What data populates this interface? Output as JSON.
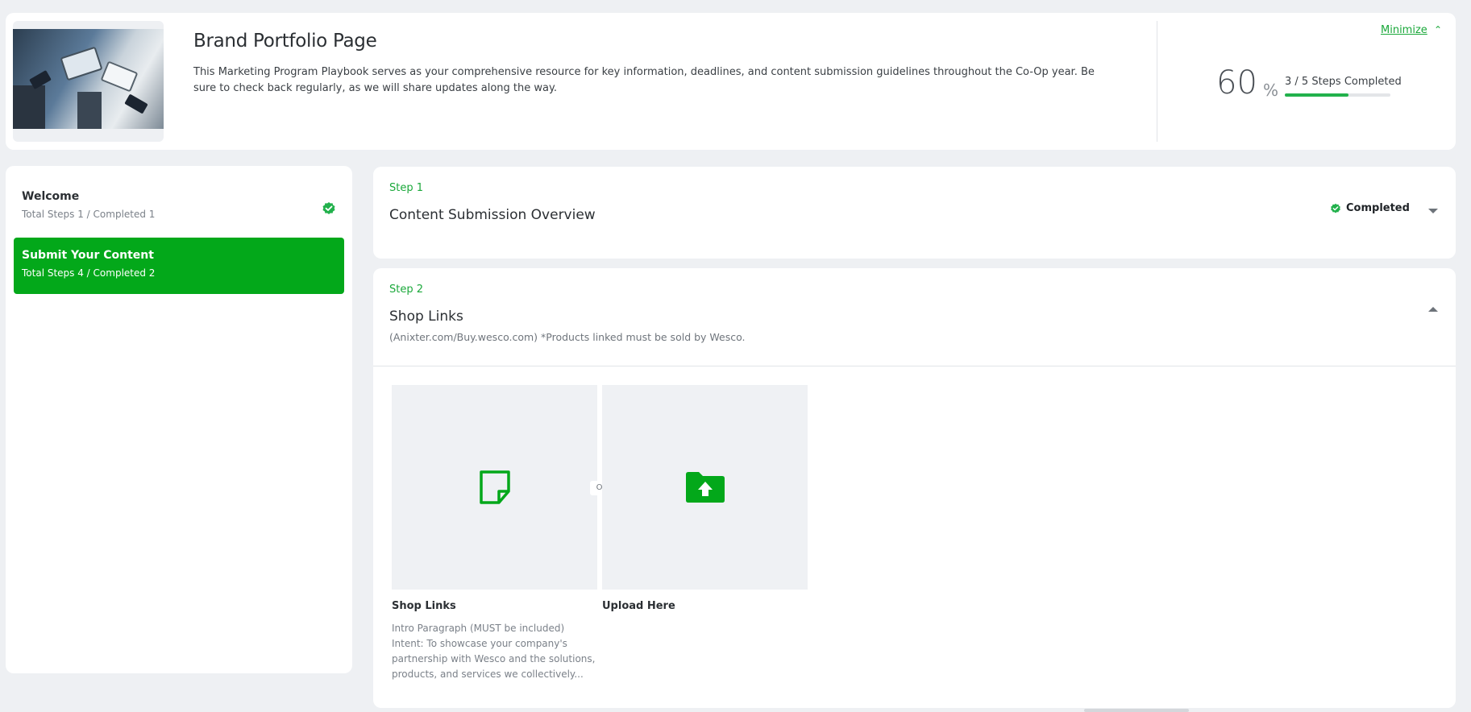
{
  "header": {
    "title": "Brand Portfolio Page",
    "description": "This Marketing Program Playbook serves as your comprehensive resource for key information, deadlines, and content submission guidelines throughout the Co-Op year. Be sure to check back regularly, as we will share updates along the way.",
    "minimize_label": "Minimize",
    "progress_percent": "60",
    "percent_sign": "%",
    "steps_completed_label": "3 / 5 Steps Completed",
    "progress_fraction": 0.6
  },
  "sidebar": {
    "items": [
      {
        "title": "Welcome",
        "subtitle": "Total Steps 1 / Completed 1",
        "completed": true
      },
      {
        "title": "Submit Your Content",
        "subtitle": "Total Steps 4 / Completed 2",
        "active": true
      }
    ]
  },
  "steps": [
    {
      "kicker": "Step 1",
      "title": "Content Submission Overview",
      "status": "Completed",
      "expanded": false
    },
    {
      "kicker": "Step 2",
      "title": "Shop Links",
      "subtitle": "(Anixter.com/Buy.wesco.com) *Products linked must be sold by Wesco.",
      "expanded": true,
      "or_label": "OR",
      "tiles": [
        {
          "label": "Shop Links",
          "icon": "note-icon",
          "description_lines": [
            "Intro Paragraph (MUST be included)",
            "Intent: To showcase your company's",
            "partnership with Wesco and the solutions,",
            "products, and services we collectively..."
          ]
        },
        {
          "label": "Upload Here",
          "icon": "folder-upload-icon"
        }
      ]
    }
  ],
  "colors": {
    "brand_green": "#03a81a",
    "link_green": "#1aa83a",
    "progress_green": "#22b14c",
    "background": "#eef0f3"
  }
}
